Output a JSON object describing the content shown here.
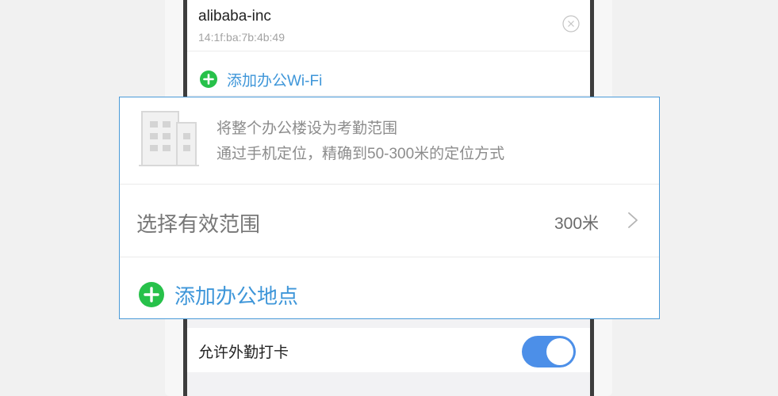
{
  "wifi": {
    "name": "alibaba-inc",
    "mac": "14:1f:ba:7b:4b:49",
    "add_label": "添加办公Wi-Fi"
  },
  "office_location": {
    "description_line1": "将整个办公楼设为考勤范围",
    "description_line2": "通过手机定位，精确到50-300米的定位方式",
    "range_label": "选择有效范围",
    "range_value": "300米",
    "add_location_label": "添加办公地点"
  },
  "outside_checkin": {
    "label": "允许外勤打卡",
    "enabled": true
  },
  "colors": {
    "accent_blue": "#3e96d9",
    "add_green": "#27c14a",
    "toggle_blue": "#4c8fe8",
    "highlight_border": "#4a9ad8"
  },
  "icons": {
    "remove": "close-circle-icon",
    "add": "plus-circle-icon",
    "building": "building-icon",
    "chevron": "chevron-right-icon"
  }
}
